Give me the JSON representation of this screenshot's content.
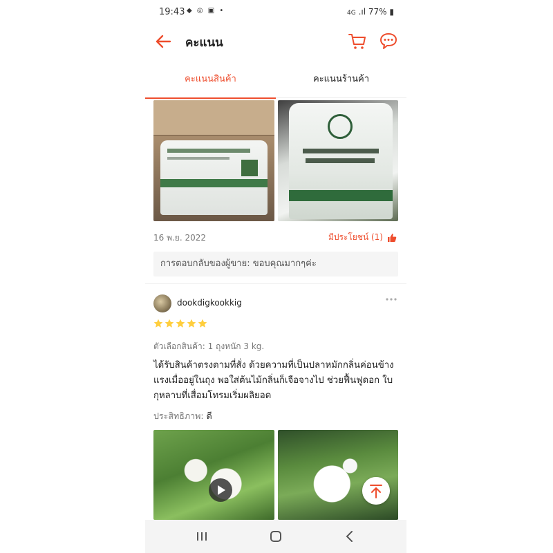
{
  "status_bar": {
    "time": "19:43",
    "battery": "77%",
    "network": "4G"
  },
  "header": {
    "title": "คะแนน"
  },
  "tabs": [
    {
      "label": "คะแนนสินค้า",
      "active": true
    },
    {
      "label": "คะแนนร้านค้า",
      "active": false
    }
  ],
  "review1": {
    "date": "16 พ.ย. 2022",
    "helpful_label": "มีประโยชน์ (1)",
    "seller_reply": "การตอบกลับของผู้ขาย: ขอบคุณมากๆค่ะ"
  },
  "review2": {
    "username": "dookdigkookkig",
    "rating": 5,
    "variant": "ตัวเลือกสินค้า: 1 ถุงหนัก 3 kg.",
    "text": "ได้รับสินค้าตรงตามที่สั่ง ด้วยความที่เป็นปลาหมักกลิ่นค่อนข้างแรงเมื่ออยู่ในถุง พอใส่ต้นไม้กลิ่นก็เจือจางไป ช่วยฟื้นฟูดอก ใบ กุหลาบที่เสื่อมโทรมเริ่มผลิยอด",
    "quality_label": "ประสิทธิภาพ:",
    "quality_value": "ดี"
  },
  "colors": {
    "accent": "#ee4d2d",
    "star": "#ffce3d"
  },
  "icons": [
    "back-arrow-icon",
    "cart-icon",
    "chat-icon",
    "thumbs-up-icon",
    "more-icon",
    "star-icon",
    "play-icon",
    "arrow-up-icon",
    "recents-icon",
    "home-icon",
    "back-icon"
  ]
}
